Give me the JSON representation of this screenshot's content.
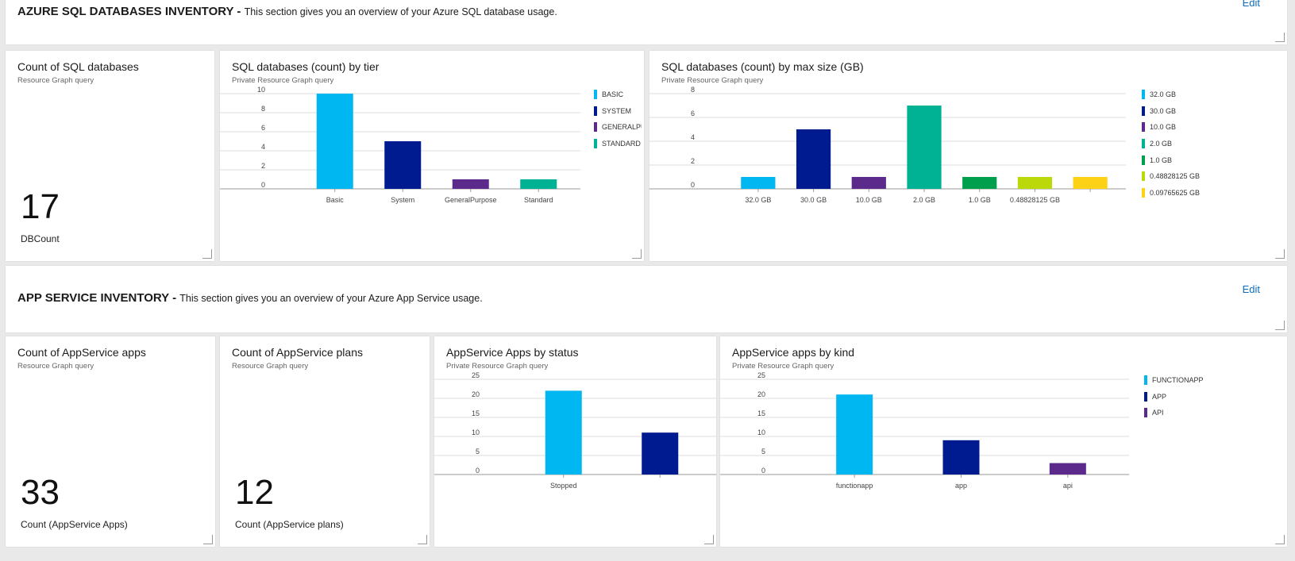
{
  "sql_section": {
    "title": "AZURE SQL DATABASES INVENTORY -",
    "description": "This section gives you an overview of your Azure SQL database usage.",
    "edit_label": "Edit"
  },
  "tile_sql_count": {
    "title": "Count of SQL databases",
    "subtitle": "Resource Graph query",
    "value": "17",
    "value_label": "DBCount"
  },
  "tile_sql_tier": {
    "title": "SQL databases (count) by tier",
    "subtitle": "Private Resource Graph query"
  },
  "tile_sql_size": {
    "title": "SQL databases (count) by max size (GB)",
    "subtitle": "Private Resource Graph query"
  },
  "app_section": {
    "title": "APP SERVICE INVENTORY -",
    "description": "This section gives you an overview of your Azure App Service usage.",
    "edit_label": "Edit"
  },
  "tile_app_count": {
    "title": "Count of AppService apps",
    "subtitle": "Resource Graph query",
    "value": "33",
    "value_label": "Count (AppService Apps)"
  },
  "tile_plan_count": {
    "title": "Count of AppService plans",
    "subtitle": "Resource Graph query",
    "value": "12",
    "value_label": "Count (AppService plans)"
  },
  "tile_app_status": {
    "title": "AppService Apps by status",
    "subtitle": "Private Resource Graph query"
  },
  "tile_app_kind": {
    "title": "AppService apps by kind",
    "subtitle": "Private Resource Graph query"
  },
  "colors": {
    "edit_link": "#0f6cbd",
    "tile_background": "#ffffff",
    "page_background": "#e9e9e9"
  },
  "chart_data": [
    {
      "id": "sql_tier",
      "type": "bar",
      "categories": [
        "Basic",
        "System",
        "GeneralPurpose",
        "Standard"
      ],
      "values": [
        10,
        5,
        1,
        1
      ],
      "colors": [
        "#00b7f1",
        "#001a8f",
        "#5c2a8a",
        "#00b294"
      ],
      "ylim": [
        0,
        10
      ],
      "yticks": [
        0,
        2,
        4,
        6,
        8,
        10
      ],
      "legend": [
        "BASIC",
        "SYSTEM",
        "GENERALPU",
        "STANDARD"
      ],
      "legend_position": "right",
      "grid": true
    },
    {
      "id": "sql_size",
      "type": "bar",
      "categories": [
        "32.0 GB",
        "30.0 GB",
        "10.0 GB",
        "2.0 GB",
        "1.0 GB",
        "0.48828125 GB",
        ""
      ],
      "values": [
        1,
        5,
        1,
        7,
        1,
        1,
        1
      ],
      "colors": [
        "#00b7f1",
        "#001a8f",
        "#5c2a8a",
        "#00b294",
        "#009f4d",
        "#bad80a",
        "#fcd116"
      ],
      "ylim": [
        0,
        8
      ],
      "yticks": [
        0,
        2,
        4,
        6,
        8
      ],
      "legend": [
        "32.0 GB",
        "30.0 GB",
        "10.0 GB",
        "2.0 GB",
        "1.0 GB",
        "0.48828125 GB",
        "0.09765625 GB"
      ],
      "legend_position": "right",
      "grid": true
    },
    {
      "id": "app_status",
      "type": "bar",
      "categories": [
        "Stopped",
        ""
      ],
      "values": [
        22,
        11
      ],
      "colors": [
        "#00b7f1",
        "#001a8f"
      ],
      "ylim": [
        0,
        25
      ],
      "yticks": [
        0,
        5,
        10,
        15,
        20,
        25
      ],
      "legend": [],
      "grid": true
    },
    {
      "id": "app_kind",
      "type": "bar",
      "categories": [
        "functionapp",
        "app",
        "api"
      ],
      "values": [
        21,
        9,
        3
      ],
      "colors": [
        "#00b7f1",
        "#001a8f",
        "#5c2a8a"
      ],
      "ylim": [
        0,
        25
      ],
      "yticks": [
        0,
        5,
        10,
        15,
        20,
        25
      ],
      "legend": [
        "FUNCTIONAPP",
        "APP",
        "API"
      ],
      "legend_position": "right",
      "grid": true
    }
  ]
}
